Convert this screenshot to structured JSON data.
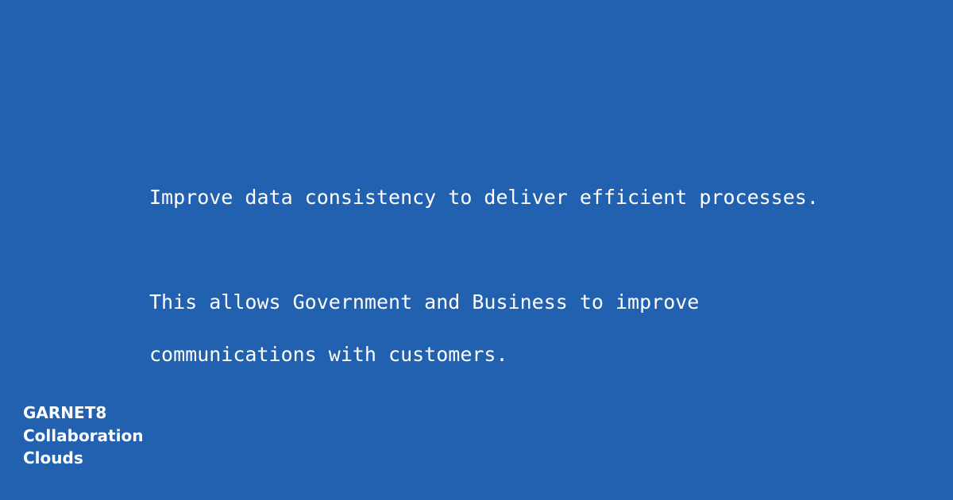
{
  "message": {
    "headline": "Improve data consistency to deliver efficient processes.",
    "body_line_1": "This allows Government and Business to improve",
    "body_line_2": "communications with customers."
  },
  "brand": {
    "line_1": "GARNET8",
    "line_2": "Collaboration",
    "line_3": "Clouds"
  },
  "colors": {
    "background": "#2161b0",
    "text": "#ffffff"
  }
}
